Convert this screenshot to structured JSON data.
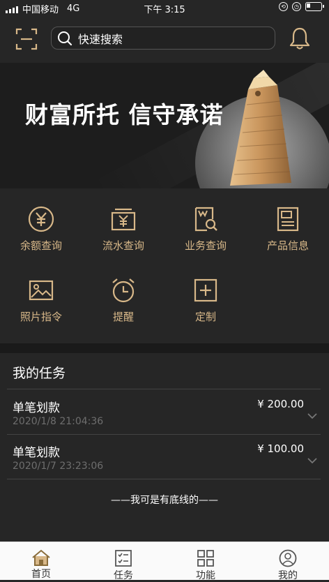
{
  "status_bar": {
    "carrier": "中国移动",
    "network": "4G",
    "time": "下午 3:15"
  },
  "search": {
    "placeholder": "快速搜索"
  },
  "banner": {
    "title": "财富所托 信守承诺"
  },
  "features": [
    {
      "label": "余额查询",
      "icon": "yuan-coin-icon"
    },
    {
      "label": "流水查询",
      "icon": "yuan-ledger-icon"
    },
    {
      "label": "业务查询",
      "icon": "document-search-icon"
    },
    {
      "label": "产品信息",
      "icon": "product-doc-icon"
    },
    {
      "label": "照片指令",
      "icon": "photo-icon"
    },
    {
      "label": "提醒",
      "icon": "alarm-clock-icon"
    },
    {
      "label": "定制",
      "icon": "plus-square-icon"
    }
  ],
  "tasks": {
    "title": "我的任务",
    "items": [
      {
        "name": "单笔划款",
        "time": "2020/1/8 21:04:36",
        "amount": "¥ 200.00"
      },
      {
        "name": "单笔划款",
        "time": "2020/1/7 23:23:06",
        "amount": "¥ 100.00"
      }
    ],
    "footer": "——我可是有底线的——"
  },
  "tabbar": [
    {
      "label": "首页",
      "icon": "home-icon",
      "active": true
    },
    {
      "label": "任务",
      "icon": "task-list-icon"
    },
    {
      "label": "功能",
      "icon": "grid-apps-icon"
    },
    {
      "label": "我的",
      "icon": "user-icon"
    }
  ],
  "colors": {
    "accent_gold": "#d8b889",
    "background": "#262626",
    "tab_active": "#8a6d3b"
  }
}
